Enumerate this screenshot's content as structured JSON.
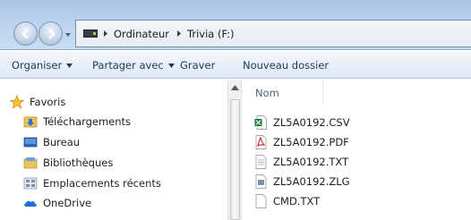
{
  "address": {
    "crumbs": [
      "Ordinateur",
      "Trivia (F:)"
    ]
  },
  "toolbar": {
    "organize_label": "Organiser",
    "share_label": "Partager avec",
    "burn_label": "Graver",
    "new_folder_label": "Nouveau dossier"
  },
  "nav": {
    "favorites_label": "Favoris",
    "items": [
      {
        "label": "Téléchargements",
        "icon": "downloads-folder-icon"
      },
      {
        "label": "Bureau",
        "icon": "desktop-icon"
      },
      {
        "label": "Bibliothèques",
        "icon": "libraries-icon"
      },
      {
        "label": "Emplacements récents",
        "icon": "recent-places-icon"
      },
      {
        "label": "OneDrive",
        "icon": "onedrive-icon"
      }
    ]
  },
  "files": {
    "column_name": "Nom",
    "items": [
      {
        "name": "ZL5A0192.CSV",
        "icon": "excel-csv-file-icon"
      },
      {
        "name": "ZL5A0192.PDF",
        "icon": "pdf-file-icon"
      },
      {
        "name": "ZL5A0192.TXT",
        "icon": "text-file-icon"
      },
      {
        "name": "ZL5A0192.ZLG",
        "icon": "generic-file-icon"
      },
      {
        "name": "CMD.TXT",
        "icon": "text-file-icon"
      }
    ]
  },
  "colors": {
    "titlebar": "#bcd3ee",
    "toolbar_text": "#1e395b",
    "header_text": "#4c607a"
  }
}
